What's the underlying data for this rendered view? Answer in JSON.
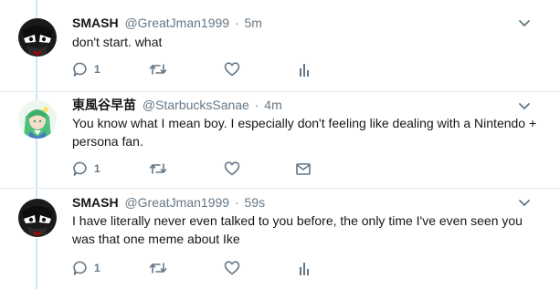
{
  "tweets": [
    {
      "name": "SMASH",
      "handle": "@GreatJman1999",
      "separator": "·",
      "time": "5m",
      "text": "don't start. what",
      "reply_count": "1",
      "avatar_icon": "mask-avatar-icon",
      "last_action_icon": "analytics-icon"
    },
    {
      "name": "東風谷早苗",
      "handle": "@StarbucksSanae",
      "separator": "·",
      "time": "4m",
      "text": "You know what I mean boy. I especially don't feeling like dealing with a Nintendo + persona fan.",
      "reply_count": "1",
      "avatar_icon": "anime-girl-avatar-icon",
      "last_action_icon": "direct-message-icon"
    },
    {
      "name": "SMASH",
      "handle": "@GreatJman1999",
      "separator": "·",
      "time": "59s",
      "text": "I have literally never even talked to you before, the only time I've even seen you was that one meme about Ike",
      "reply_count": "1",
      "avatar_icon": "mask-avatar-icon",
      "last_action_icon": "analytics-icon"
    }
  ],
  "colors": {
    "thread_line": "#cfe6f7",
    "secondary_text": "#657786",
    "icon_gray": "#657786",
    "separator": "#e6ecf0"
  }
}
